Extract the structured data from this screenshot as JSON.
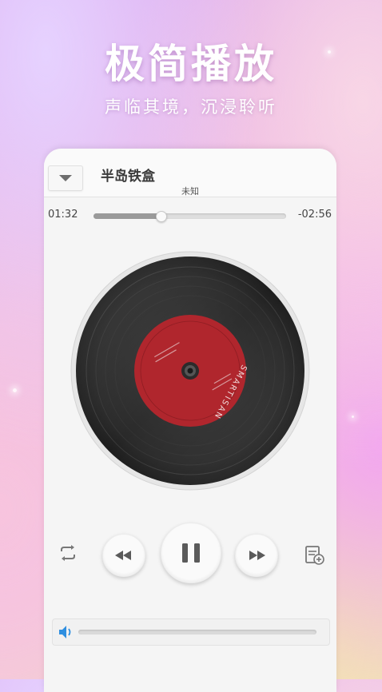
{
  "promo": {
    "headline": "极简播放",
    "subline": "声临其境，沉浸聆听"
  },
  "player": {
    "song_title": "半岛铁盒",
    "artist": "未知",
    "time_elapsed": "01:32",
    "time_remaining": "-02:56",
    "progress_fraction": 0.35,
    "volume_fraction": 0.0,
    "record_label_text": "SMARTISAN"
  },
  "icons": {
    "collapse": "chevron-down-icon",
    "repeat": "repeat-icon",
    "previous": "previous-icon",
    "play_pause": "pause-icon",
    "next": "next-icon",
    "add_to_playlist": "playlist-add-icon",
    "volume": "volume-icon"
  },
  "colors": {
    "record_label": "#b0262d",
    "volume_accent": "#2f8fe0",
    "progress_fill": "#9a9a9a"
  }
}
